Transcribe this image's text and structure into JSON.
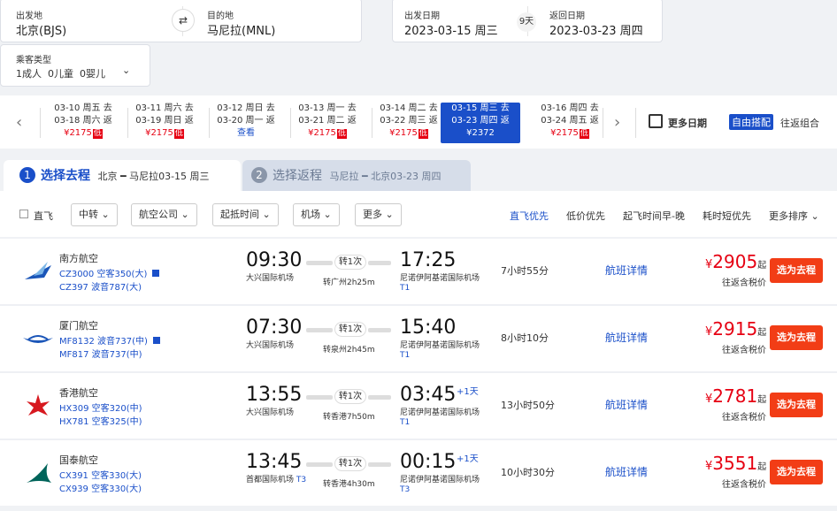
{
  "search": {
    "from_label": "出发地",
    "from_value": "北京(BJS)",
    "swap_icon": "⇄",
    "to_label": "目的地",
    "to_value": "马尼拉(MNL)",
    "depart_label": "出发日期",
    "depart_value": "2023-03-15 周三",
    "days": "9天",
    "return_label": "返回日期",
    "return_value": "2023-03-23 周四",
    "passenger_label": "乘客类型",
    "passenger_value": "1成人  0儿童  0婴儿"
  },
  "dates": [
    {
      "go": "03-10 周五 去",
      "back": "03-18 周六 返",
      "price": "¥2175",
      "tag": "低"
    },
    {
      "go": "03-11 周六 去",
      "back": "03-19 周日 返",
      "price": "¥2175",
      "tag": "低"
    },
    {
      "go": "03-12 周日 去",
      "back": "03-20 周一 返",
      "price": "查看",
      "tag": ""
    },
    {
      "go": "03-13 周一 去",
      "back": "03-21 周二 返",
      "price": "¥2175",
      "tag": "低"
    },
    {
      "go": "03-14 周二 去",
      "back": "03-22 周三 返",
      "price": "¥2175",
      "tag": "低"
    },
    {
      "go": "03-15 周三 去",
      "back": "03-23 周四 返",
      "price": "¥2372",
      "tag": ""
    },
    {
      "go": "03-16 周四 去",
      "back": "03-24 周五 返",
      "price": "¥2175",
      "tag": "低"
    }
  ],
  "more_dates": "更多日期",
  "free_combo": "自由搭配",
  "free_combo_suffix": "往返组合",
  "tab1": {
    "num": "1",
    "title": "选择去程",
    "route": "北京 ━ 马尼拉03-15 周三"
  },
  "tab2": {
    "num": "2",
    "title": "选择返程",
    "route": "马尼拉 ━ 北京03-23 周四"
  },
  "filters": {
    "direct": "直飞",
    "transfer": "中转",
    "airline": "航空公司",
    "time": "起抵时间",
    "airport": "机场",
    "more": "更多"
  },
  "sorts": [
    "直飞优先",
    "低价优先",
    "起飞时间早-晚",
    "耗时短优先",
    "更多排序"
  ],
  "flights": [
    {
      "airline": "南方航空",
      "f1": "CZ3000 空客350(大)",
      "f2": "CZ397 波音787(大)",
      "dep": "09:30",
      "dep_ap": "大兴国际机场",
      "dep_t": "",
      "transfer": "转1次",
      "via": "转广州2h25m",
      "arr": "17:25",
      "plus": "",
      "arr_ap": "尼诺伊阿基诺国际机场",
      "arr_t": "T1",
      "dur": "7小时55分",
      "detail": "航班详情",
      "price": "2905",
      "qi": "起",
      "tax": "往返含税价",
      "btn": "选为去程"
    },
    {
      "airline": "厦门航空",
      "f1": "MF8132 波音737(中)",
      "f2": "MF817 波音737(中)",
      "dep": "07:30",
      "dep_ap": "大兴国际机场",
      "dep_t": "",
      "transfer": "转1次",
      "via": "转泉州2h45m",
      "arr": "15:40",
      "plus": "",
      "arr_ap": "尼诺伊阿基诺国际机场",
      "arr_t": "T1",
      "dur": "8小时10分",
      "detail": "航班详情",
      "price": "2915",
      "qi": "起",
      "tax": "往返含税价",
      "btn": "选为去程"
    },
    {
      "airline": "香港航空",
      "f1": "HX309 空客320(中)",
      "f2": "HX781 空客325(中)",
      "dep": "13:55",
      "dep_ap": "大兴国际机场",
      "dep_t": "",
      "transfer": "转1次",
      "via": "转香港7h50m",
      "arr": "03:45",
      "plus": "+1天",
      "arr_ap": "尼诺伊阿基诺国际机场",
      "arr_t": "T1",
      "dur": "13小时50分",
      "detail": "航班详情",
      "price": "2781",
      "qi": "起",
      "tax": "往返含税价",
      "btn": "选为去程"
    },
    {
      "airline": "国泰航空",
      "f1": "CX391 空客330(大)",
      "f2": "CX939 空客330(大)",
      "dep": "13:45",
      "dep_ap": "首都国际机场",
      "dep_t": "T3",
      "transfer": "转1次",
      "via": "转香港4h30m",
      "arr": "00:15",
      "plus": "+1天",
      "arr_ap": "尼诺伊阿基诺国际机场",
      "arr_t": "T3",
      "dur": "10小时30分",
      "detail": "航班详情",
      "price": "3551",
      "qi": "起",
      "tax": "往返含税价",
      "btn": "选为去程"
    }
  ],
  "colors": {
    "accent": "#1a4fc9",
    "price": "#e60012",
    "button": "#f23d16"
  }
}
